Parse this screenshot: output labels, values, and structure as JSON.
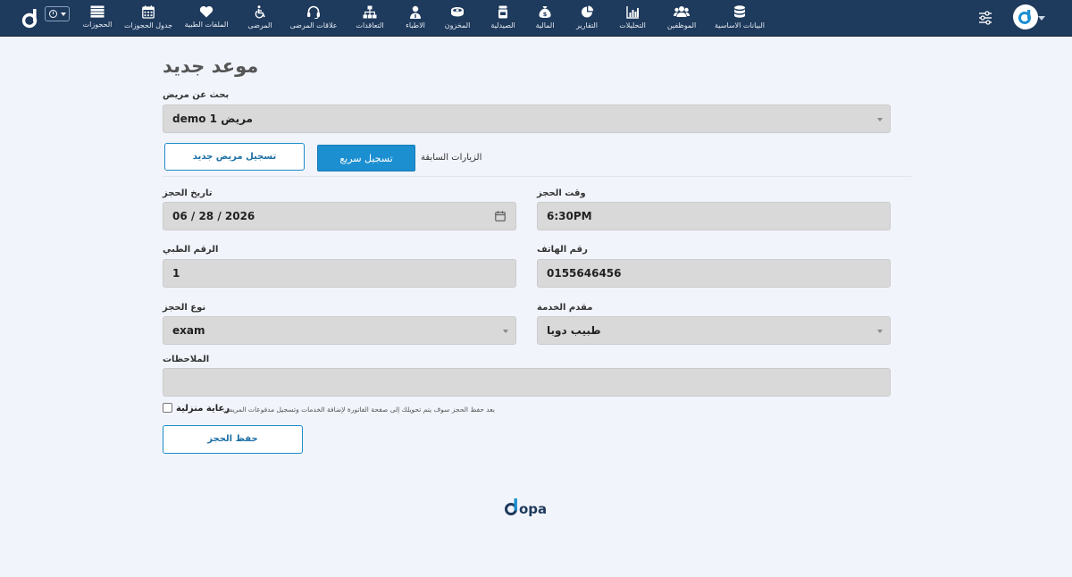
{
  "app": {
    "brand_color": "#1e3a5c",
    "accent_color": "#1c8fd1"
  },
  "nav": {
    "items": [
      {
        "label": "البيانات الاساسية",
        "icon": "database-icon"
      },
      {
        "label": "الموظفين",
        "icon": "users-icon"
      },
      {
        "label": "التحليلات",
        "icon": "bar-chart-icon"
      },
      {
        "label": "التقارير",
        "icon": "pie-chart-icon"
      },
      {
        "label": "المالية",
        "icon": "money-bag-icon"
      },
      {
        "label": "الصيدلية",
        "icon": "medicine-icon"
      },
      {
        "label": "المخزون",
        "icon": "boxes-icon"
      },
      {
        "label": "الاطباء",
        "icon": "doctor-icon"
      },
      {
        "label": "التعاقدات",
        "icon": "org-chart-icon"
      },
      {
        "label": "علاقات المرضى",
        "icon": "headset-icon"
      },
      {
        "label": "المرضى",
        "icon": "wheelchair-icon"
      },
      {
        "label": "الملفات الطبية",
        "icon": "heart-icon"
      },
      {
        "label": "جدول الحجوزات",
        "icon": "calendar-icon"
      },
      {
        "label": "الحجوزات",
        "icon": "list-icon"
      }
    ]
  },
  "page": {
    "title": "موعد جديد"
  },
  "form": {
    "patient_search_label": "بحث عن مريض",
    "patient_search_value": "مريض demo 1",
    "previous_visits_label": "الزيارات السابقة",
    "quick_register_label": "تسجيل سريع",
    "new_patient_label": "تسجيل مريض جديد",
    "booking_date_label": "تاريخ الحجز",
    "booking_date_value": "06 / 28 / 2026",
    "booking_time_label": "وقت الحجز",
    "booking_time_value": "6:30PM",
    "medical_number_label": "الرقم الطبي",
    "medical_number_value": "1",
    "phone_label": "رقم الهاتف",
    "phone_value": "0155646456",
    "booking_type_label": "نوع الحجز",
    "booking_type_value": "exam",
    "provider_label": "مقدم الخدمة",
    "provider_value": "طبيب دوبا",
    "notes_label": "الملاحظات",
    "notes_value": "",
    "home_care_label": "رعاية منزلية",
    "home_care_checked": false,
    "hint_text": "بعد حفظ الحجز سوف يتم تحويلك إلى صفحة الفاتورة لإضافة الخدمات وتسجيل مدفوعات المريض.",
    "save_label": "حفظ الحجز"
  },
  "footer": {
    "logo_text": "dopa"
  }
}
